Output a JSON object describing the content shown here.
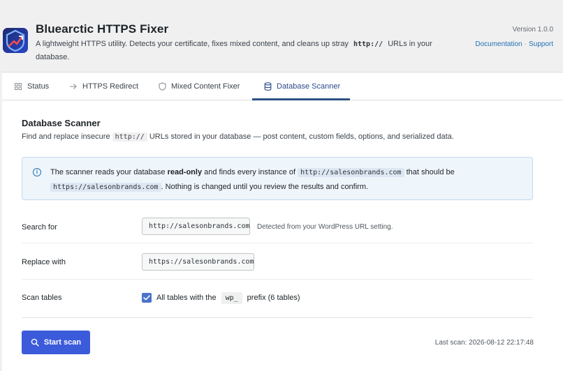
{
  "app": {
    "title": "Bluearctic HTTPS Fixer",
    "desc_part1": "A lightweight HTTPS utility. Detects your certificate, fixes mixed content, and cleans up stray",
    "desc_code": "http://",
    "desc_part2": "URLs in your database.",
    "version": "Version 1.0.0",
    "documentation_label": "Documentation",
    "link_separator": "·",
    "support_label": "Support",
    "logo_icon": "shield-arrow-logo-icon"
  },
  "tabs": [
    {
      "label": "Status",
      "icon": "grid-icon"
    },
    {
      "label": "HTTPS Redirect",
      "icon": "arrow-right-icon"
    },
    {
      "label": "Mixed Content Fixer",
      "icon": "shield-icon"
    },
    {
      "label": "Database Scanner",
      "icon": "database-icon",
      "active": true
    }
  ],
  "scanner": {
    "title": "Database Scanner",
    "desc_part1": "Find and replace insecure",
    "desc_code": "http://",
    "desc_part2": "URLs stored in your database — post content, custom fields, options, and serialized data."
  },
  "notice": {
    "icon": "info-icon",
    "part1": "The scanner reads your database",
    "bold": "read-only",
    "part2": "and finds every instance of",
    "code1": "http://salesonbrands.com",
    "part3": "that should be",
    "code2": "https://salesonbrands.com",
    "part4": ". Nothing is changed until you review the results and confirm."
  },
  "form": {
    "search_label": "Search for",
    "search_value": "http://salesonbrands.com",
    "search_hint": "Detected from your WordPress URL setting.",
    "replace_label": "Replace with",
    "replace_value": "https://salesonbrands.com",
    "tables_label": "Scan tables",
    "tables_checked": true,
    "tables_text1": "All tables with the",
    "tables_prefix": "wp_",
    "tables_text2": "prefix (6 tables)"
  },
  "actions": {
    "start_label": "Start scan",
    "start_icon": "search-icon",
    "last_scan": "Last scan: 2026-08-12 22:17:48"
  },
  "colors": {
    "accent": "#3b5bdb",
    "link": "#2271b1",
    "notice_bg": "#eef5fb"
  }
}
